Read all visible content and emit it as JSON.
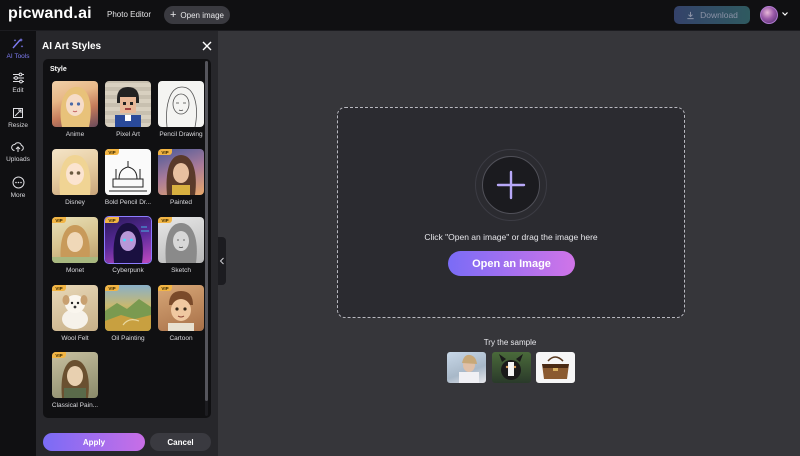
{
  "app": {
    "logo_main": "picwand.",
    "logo_suffix": "ai"
  },
  "topbar": {
    "nav_label": "Photo Editor",
    "open_image_label": "Open image",
    "download_label": "Download"
  },
  "rail": {
    "items": [
      {
        "label": "AI Tools",
        "icon": "ai-tools-icon",
        "active": true
      },
      {
        "label": "Edit",
        "icon": "sliders-icon",
        "active": false
      },
      {
        "label": "Resize",
        "icon": "resize-icon",
        "active": false
      },
      {
        "label": "Uploads",
        "icon": "upload-icon",
        "active": false
      },
      {
        "label": "More",
        "icon": "more-icon",
        "active": false
      }
    ]
  },
  "panel": {
    "title": "AI Art Styles",
    "section_label": "Style",
    "styles": [
      {
        "label": "Anime",
        "vip": false,
        "selected": false
      },
      {
        "label": "Pixel Art",
        "vip": false,
        "selected": false
      },
      {
        "label": "Pencil Drawing",
        "vip": false,
        "selected": false
      },
      {
        "label": "Disney",
        "vip": false,
        "selected": false
      },
      {
        "label": "Bold Pencil Dr...",
        "vip": true,
        "selected": false
      },
      {
        "label": "Painted",
        "vip": true,
        "selected": false
      },
      {
        "label": "Monet",
        "vip": true,
        "selected": false
      },
      {
        "label": "Cyberpunk",
        "vip": true,
        "selected": true
      },
      {
        "label": "Sketch",
        "vip": true,
        "selected": false
      },
      {
        "label": "Wool Felt",
        "vip": true,
        "selected": false
      },
      {
        "label": "Oil Painting",
        "vip": true,
        "selected": false
      },
      {
        "label": "Cartoon",
        "vip": true,
        "selected": false
      },
      {
        "label": "Classical Pain...",
        "vip": true,
        "selected": false
      }
    ],
    "vip_badge": "VIP",
    "apply_label": "Apply",
    "cancel_label": "Cancel"
  },
  "canvas": {
    "drop_text": "Click \"Open an image\" or drag the image here",
    "open_button_label": "Open an Image",
    "sample_title": "Try the sample"
  },
  "colors": {
    "accent": "#7a6cf6",
    "accent_2": "#d074e8",
    "vip": "#f2b544",
    "background": "#36363a",
    "panel": "#27272b"
  }
}
